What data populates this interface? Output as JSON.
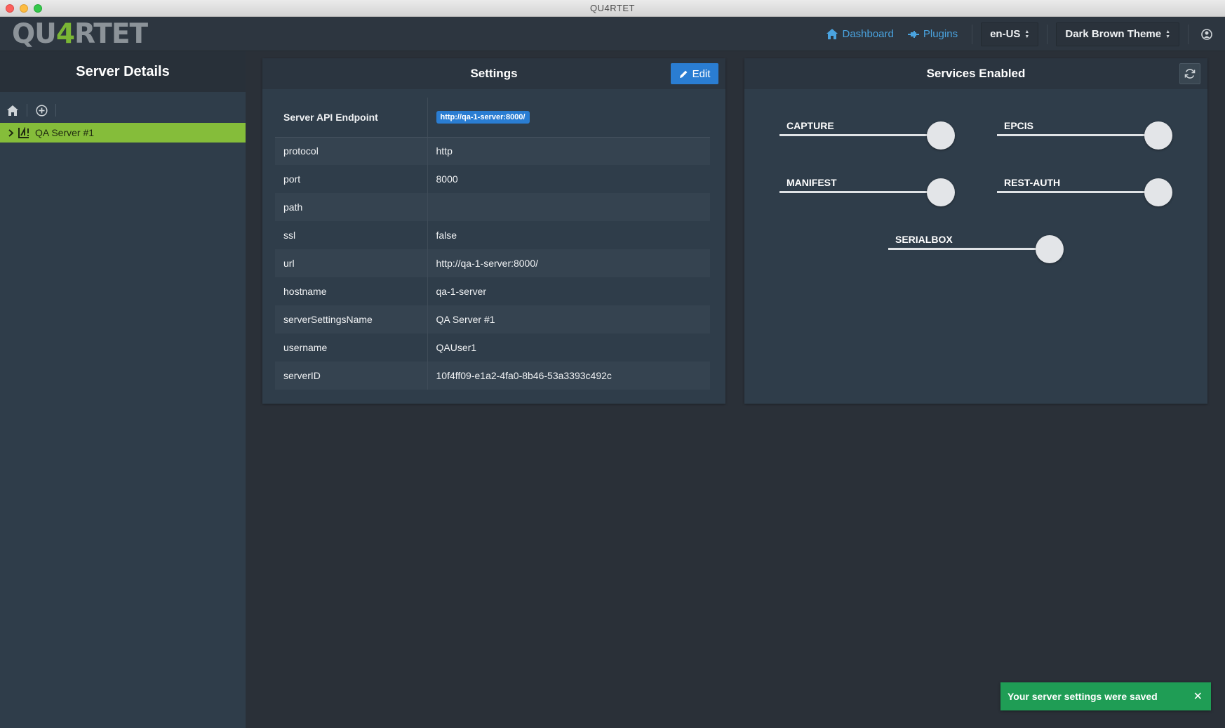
{
  "window": {
    "title": "QU4RTET"
  },
  "logo": {
    "prefix": "QU",
    "accent": "4",
    "suffix": "RTET"
  },
  "nav": {
    "dashboard_label": "Dashboard",
    "plugins_label": "Plugins",
    "language": "en-US",
    "theme": "Dark Brown Theme"
  },
  "sidebar": {
    "title": "Server Details",
    "items": [
      {
        "label": "QA Server #1"
      }
    ]
  },
  "settings": {
    "title": "Settings",
    "edit_label": "Edit",
    "endpoint_label": "Server API Endpoint",
    "endpoint_value": "http://qa-1-server:8000/",
    "rows": [
      {
        "key": "protocol",
        "value": "http"
      },
      {
        "key": "port",
        "value": "8000"
      },
      {
        "key": "path",
        "value": ""
      },
      {
        "key": "ssl",
        "value": "false"
      },
      {
        "key": "url",
        "value": "http://qa-1-server:8000/"
      },
      {
        "key": "hostname",
        "value": "qa-1-server"
      },
      {
        "key": "serverSettingsName",
        "value": "QA Server #1"
      },
      {
        "key": "username",
        "value": "QAUser1"
      },
      {
        "key": "serverID",
        "value": "10f4ff09-e1a2-4fa0-8b46-53a3393c492c"
      }
    ]
  },
  "services": {
    "title": "Services Enabled",
    "toggles": [
      {
        "label": "CAPTURE"
      },
      {
        "label": "EPCIS"
      },
      {
        "label": "MANIFEST"
      },
      {
        "label": "REST-AUTH"
      },
      {
        "label": "SERIALBOX"
      }
    ]
  },
  "toast": {
    "message": "Your server settings were saved"
  },
  "colors": {
    "accent_green": "#85bd3a",
    "link_blue": "#4aa3df",
    "button_blue": "#2a7dd2",
    "toast_green": "#1f9d55"
  }
}
